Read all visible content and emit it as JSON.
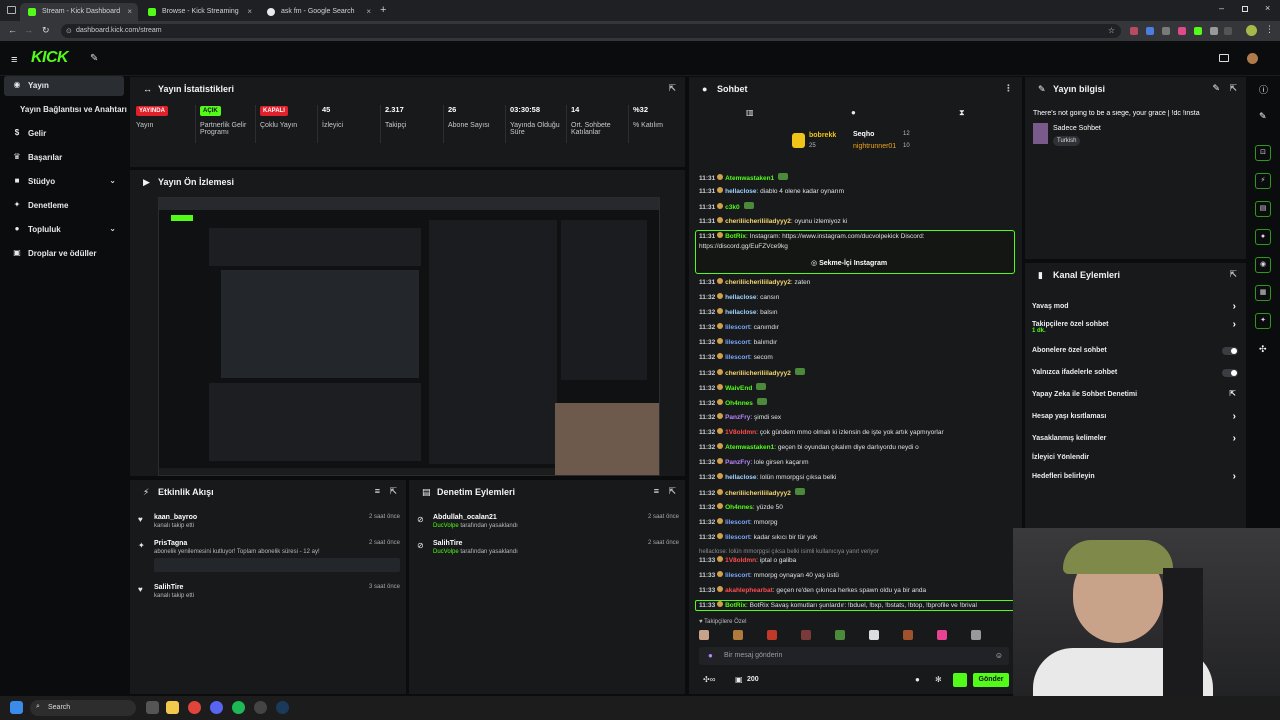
{
  "browser": {
    "tabs": [
      "Stream - Kick Dashboard",
      "Browse - Kick Streaming",
      "ask fm - Google Search"
    ],
    "url": "dashboard.kick.com/stream"
  },
  "sidebar": {
    "items": [
      "Yayın",
      "Yayın Bağlantısı ve Anahtarı",
      "Gelir",
      "Başarılar",
      "Stüdyo",
      "Denetleme",
      "Topluluk",
      "Droplar ve ödüller"
    ]
  },
  "stats": {
    "title": "Yayın İstatistikleri",
    "items": [
      {
        "value": "YAYINDA",
        "label": "Yayın",
        "badge": true,
        "color": "#e0202a"
      },
      {
        "value": "AÇIK",
        "label": "Partnerlik Gelir Programı",
        "badge": true,
        "color": "#53fc18"
      },
      {
        "value": "KAPALI",
        "label": "Çoklu Yayın",
        "badge": true,
        "color": "#e0202a"
      },
      {
        "value": "45",
        "label": "İzleyici"
      },
      {
        "value": "2.317",
        "label": "Takipçi"
      },
      {
        "value": "26",
        "label": "Abone Sayısı"
      },
      {
        "value": "03:30:58",
        "label": "Yayında Olduğu Süre"
      },
      {
        "value": "14",
        "label": "Ort. Sohbete Katılanlar"
      },
      {
        "value": "%32",
        "label": "% Katılım"
      }
    ]
  },
  "preview": {
    "title": "Yayın Ön İzlemesi"
  },
  "activity": {
    "title": "Etkinlik Akışı",
    "items": [
      {
        "name": "kaan_bayroo",
        "desc": "kanalı takip etti",
        "time": "2 saat önce",
        "icon": "heart-icon"
      },
      {
        "name": "PrisTagna",
        "desc": "abonelik yenilemesini kutluyor! Toplam abonelik süresi - 12 ay!",
        "time": "2 saat önce",
        "icon": "star-icon"
      },
      {
        "name": "SalihTire",
        "desc": "kanalı takip etti",
        "time": "3 saat önce",
        "icon": "heart-icon"
      }
    ]
  },
  "moderation": {
    "title": "Denetim Eylemleri",
    "items": [
      {
        "name": "Abdullah_ocalan21",
        "by": "DucVolpe",
        "desc": "tarafından yasaklandı",
        "time": "2 saat önce"
      },
      {
        "name": "SalihTire",
        "by": "DucVolpe",
        "desc": "tarafından yasaklandı",
        "time": "2 saat önce"
      }
    ]
  },
  "chat": {
    "title": "Sohbet",
    "top": [
      {
        "name": "bobrekk",
        "num": "25"
      },
      {
        "name": "Seqho",
        "num": "12"
      },
      {
        "name": "nightrunner01",
        "num": "10"
      }
    ],
    "messages": [
      {
        "t": "11:31",
        "u": "Atemwastaken1",
        "m": "",
        "c": "#53fc18"
      },
      {
        "t": "11:31",
        "u": "hellaclose",
        "m": "diablo 4 olene kadar oynarım",
        "c": "#9fd3ff"
      },
      {
        "t": "11:31",
        "u": "c3k0",
        "m": "",
        "c": "#53fc18"
      },
      {
        "t": "11:31",
        "u": "cheriliicheriliiladyyy2",
        "m": "oyunu izlemiyoz ki",
        "c": "#f5d76e"
      },
      {
        "t": "11:31",
        "u": "BotRix",
        "m": "Instagram: https://www.instagram.com/ducvolpekick Discord: https://discord.gg/EuFZVce9kg",
        "c": "#53fc18"
      },
      {
        "t": "11:31",
        "u": "cheriliicheriliiladyyy2",
        "m": "zaten",
        "c": "#f5d76e"
      },
      {
        "t": "11:32",
        "u": "hellaclose",
        "m": "cansın",
        "c": "#9fd3ff"
      },
      {
        "t": "11:32",
        "u": "hellaclose",
        "m": "balsın",
        "c": "#9fd3ff"
      },
      {
        "t": "11:32",
        "u": "lilescort",
        "m": "canımdır",
        "c": "#7aa7ff"
      },
      {
        "t": "11:32",
        "u": "lilescort",
        "m": "balımdır",
        "c": "#7aa7ff"
      },
      {
        "t": "11:32",
        "u": "lilescort",
        "m": "secom",
        "c": "#7aa7ff"
      },
      {
        "t": "11:32",
        "u": "cheriliicheriliiladyyy2",
        "m": "",
        "c": "#f5d76e"
      },
      {
        "t": "11:32",
        "u": "WaivEnd",
        "m": "",
        "c": "#53fc18"
      },
      {
        "t": "11:32",
        "u": "Oh4nnes",
        "m": "",
        "c": "#53fc18"
      },
      {
        "t": "11:32",
        "u": "PanzFry",
        "m": "şimdi sex",
        "c": "#b985ff"
      },
      {
        "t": "11:32",
        "u": "1V8oldmn",
        "m": "çok gündem mmo olmalı ki izlensin de işte yok artık yapmıyorlar",
        "c": "#ff4d4d"
      },
      {
        "t": "11:32",
        "u": "Atemwastaken1",
        "m": "geçen bi oyundan çıkalım diye darlıyordu neydi o",
        "c": "#53fc18"
      },
      {
        "t": "11:32",
        "u": "PanzFry",
        "m": "lole girsen kaçarım",
        "c": "#b985ff"
      },
      {
        "t": "11:32",
        "u": "hellaclose",
        "m": "lolün mmorpgsi çıksa belki",
        "c": "#9fd3ff"
      },
      {
        "t": "11:32",
        "u": "cheriliicheriliiladyyy2",
        "m": "",
        "c": "#f5d76e"
      },
      {
        "t": "11:32",
        "u": "Oh4nnes",
        "m": "yüzde 50",
        "c": "#53fc18"
      },
      {
        "t": "11:32",
        "u": "lilescort",
        "m": "mmorpg",
        "c": "#7aa7ff"
      },
      {
        "t": "11:32",
        "u": "lilescort",
        "m": "kadar sıkıcı bir tür yok",
        "c": "#7aa7ff"
      },
      {
        "t": "",
        "u": "",
        "m": "hellaclose: lolün mmorpgsi çıksa belki isimli kullanıcıya yanıt veriyor",
        "c": "#888"
      },
      {
        "t": "11:33",
        "u": "1V8oldmn",
        "m": "iptal o galiba",
        "c": "#ff4d4d"
      },
      {
        "t": "11:33",
        "u": "lilescort",
        "m": "mmorpg oynayan 40 yaş üstü",
        "c": "#7aa7ff"
      },
      {
        "t": "11:33",
        "u": "akahlephearbat",
        "m": "geçen re'den çıkınca herkes spawn oldu ya bir anda",
        "c": "#ff4d4d"
      },
      {
        "t": "11:33",
        "u": "BotRix",
        "m": "BotRix Savaş komutları şunlardır: !bduel, !bxp, !bstats, !btop, !bprofile ve !brival",
        "c": "#53fc18"
      }
    ],
    "instagram_button": "Sekme-İçi Instagram",
    "followers_only": "Takipçilere Özel",
    "placeholder": "Bir mesaj gönderin",
    "count": "200",
    "send": "Gönder"
  },
  "info": {
    "title": "Yayın bilgisi",
    "stream_title": "There's not going to be a siege, your grace | !dc !insta",
    "category": "Sadece Sohbet",
    "tag": "Turkish"
  },
  "channel_actions": {
    "title": "Kanal Eylemleri",
    "items": [
      {
        "label": "Yavaş mod",
        "type": "chevron"
      },
      {
        "label": "Takipçilere özel sohbet",
        "sub": "1 dk.",
        "type": "chevron"
      },
      {
        "label": "Abonelere özel sohbet",
        "type": "toggle"
      },
      {
        "label": "Yalnızca ifadelerle sohbet",
        "type": "toggle"
      },
      {
        "label": "Yapay Zeka ile Sohbet Denetimi",
        "type": "ext"
      },
      {
        "label": "Hesap yaşı kısıtlaması",
        "type": "chevron"
      },
      {
        "label": "Yasaklanmış kelimeler",
        "type": "chevron"
      },
      {
        "label": "İzleyici Yönlendir",
        "type": "none"
      },
      {
        "label": "Hedefleri belirleyin",
        "type": "chevron"
      }
    ]
  },
  "taskbar": {
    "search": "Search"
  },
  "colors": {
    "accent": "#53fc18",
    "panel": "#17191b",
    "live": "#e0202a"
  }
}
